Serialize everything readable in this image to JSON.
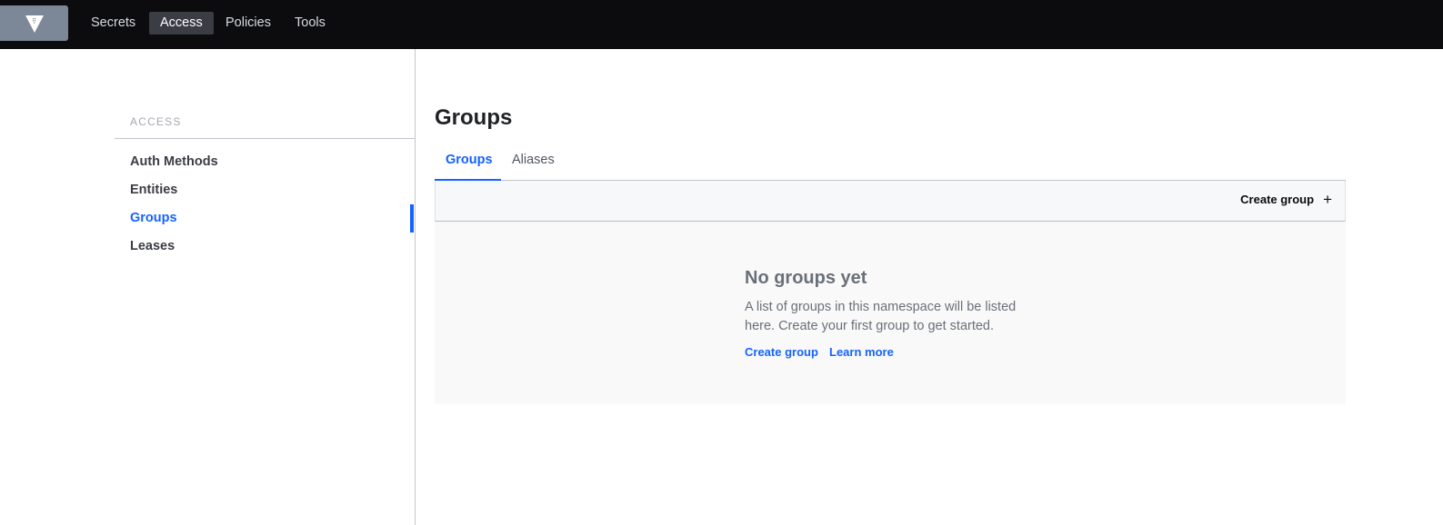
{
  "topnav": {
    "logo_icon": "vault-logo-icon",
    "items": [
      {
        "label": "Secrets",
        "active": false
      },
      {
        "label": "Access",
        "active": true
      },
      {
        "label": "Policies",
        "active": false
      },
      {
        "label": "Tools",
        "active": false
      }
    ]
  },
  "sidebar": {
    "heading": "ACCESS",
    "items": [
      {
        "label": "Auth Methods",
        "active": false
      },
      {
        "label": "Entities",
        "active": false
      },
      {
        "label": "Groups",
        "active": true
      },
      {
        "label": "Leases",
        "active": false
      }
    ]
  },
  "main": {
    "title": "Groups",
    "tabs": [
      {
        "label": "Groups",
        "active": true
      },
      {
        "label": "Aliases",
        "active": false
      }
    ],
    "toolbar": {
      "create_label": "Create group",
      "create_icon": "plus-icon"
    },
    "empty_state": {
      "title": "No groups yet",
      "message": "A list of groups in this namespace will be listed here. Create your first group to get started.",
      "create_link": "Create group",
      "learn_link": "Learn more"
    }
  },
  "colors": {
    "accent": "#1563ff",
    "nav_bg": "#0c0c0e",
    "logo_bg": "#7c8797"
  }
}
